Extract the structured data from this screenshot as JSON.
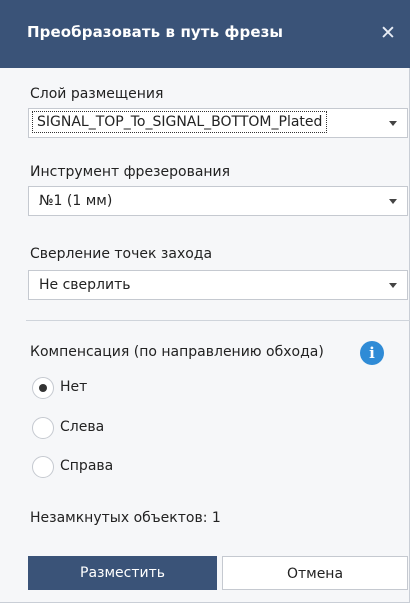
{
  "dialog": {
    "title": "Преобразовать в путь фрезы",
    "close_symbol": "✕"
  },
  "layer": {
    "label": "Слой размещения",
    "value": "SIGNAL_TOP_To_SIGNAL_BOTTOM_Plated"
  },
  "tool": {
    "label": "Инструмент фрезерования",
    "value": "№1 (1 мм)"
  },
  "drilling": {
    "label": "Сверление точек захода",
    "value": "Не сверлить"
  },
  "compensation": {
    "label": "Компенсация (по направлению обхода)",
    "info_symbol": "i",
    "options": [
      {
        "label": "Нет",
        "checked": true
      },
      {
        "label": "Слева",
        "checked": false
      },
      {
        "label": "Справа",
        "checked": false
      }
    ]
  },
  "status": {
    "unclosed_text": "Незамкнутых объектов: 1"
  },
  "buttons": {
    "place_label": "Разместить",
    "cancel_label": "Отмена"
  },
  "icons": {
    "close": "close-icon",
    "info": "info-icon",
    "dropdown": "chevron-down-icon"
  },
  "colors": {
    "titlebar": "#3a5378",
    "primary_button": "#3a5378",
    "info_icon": "#2f8bd6",
    "background": "#f6f7f9"
  }
}
